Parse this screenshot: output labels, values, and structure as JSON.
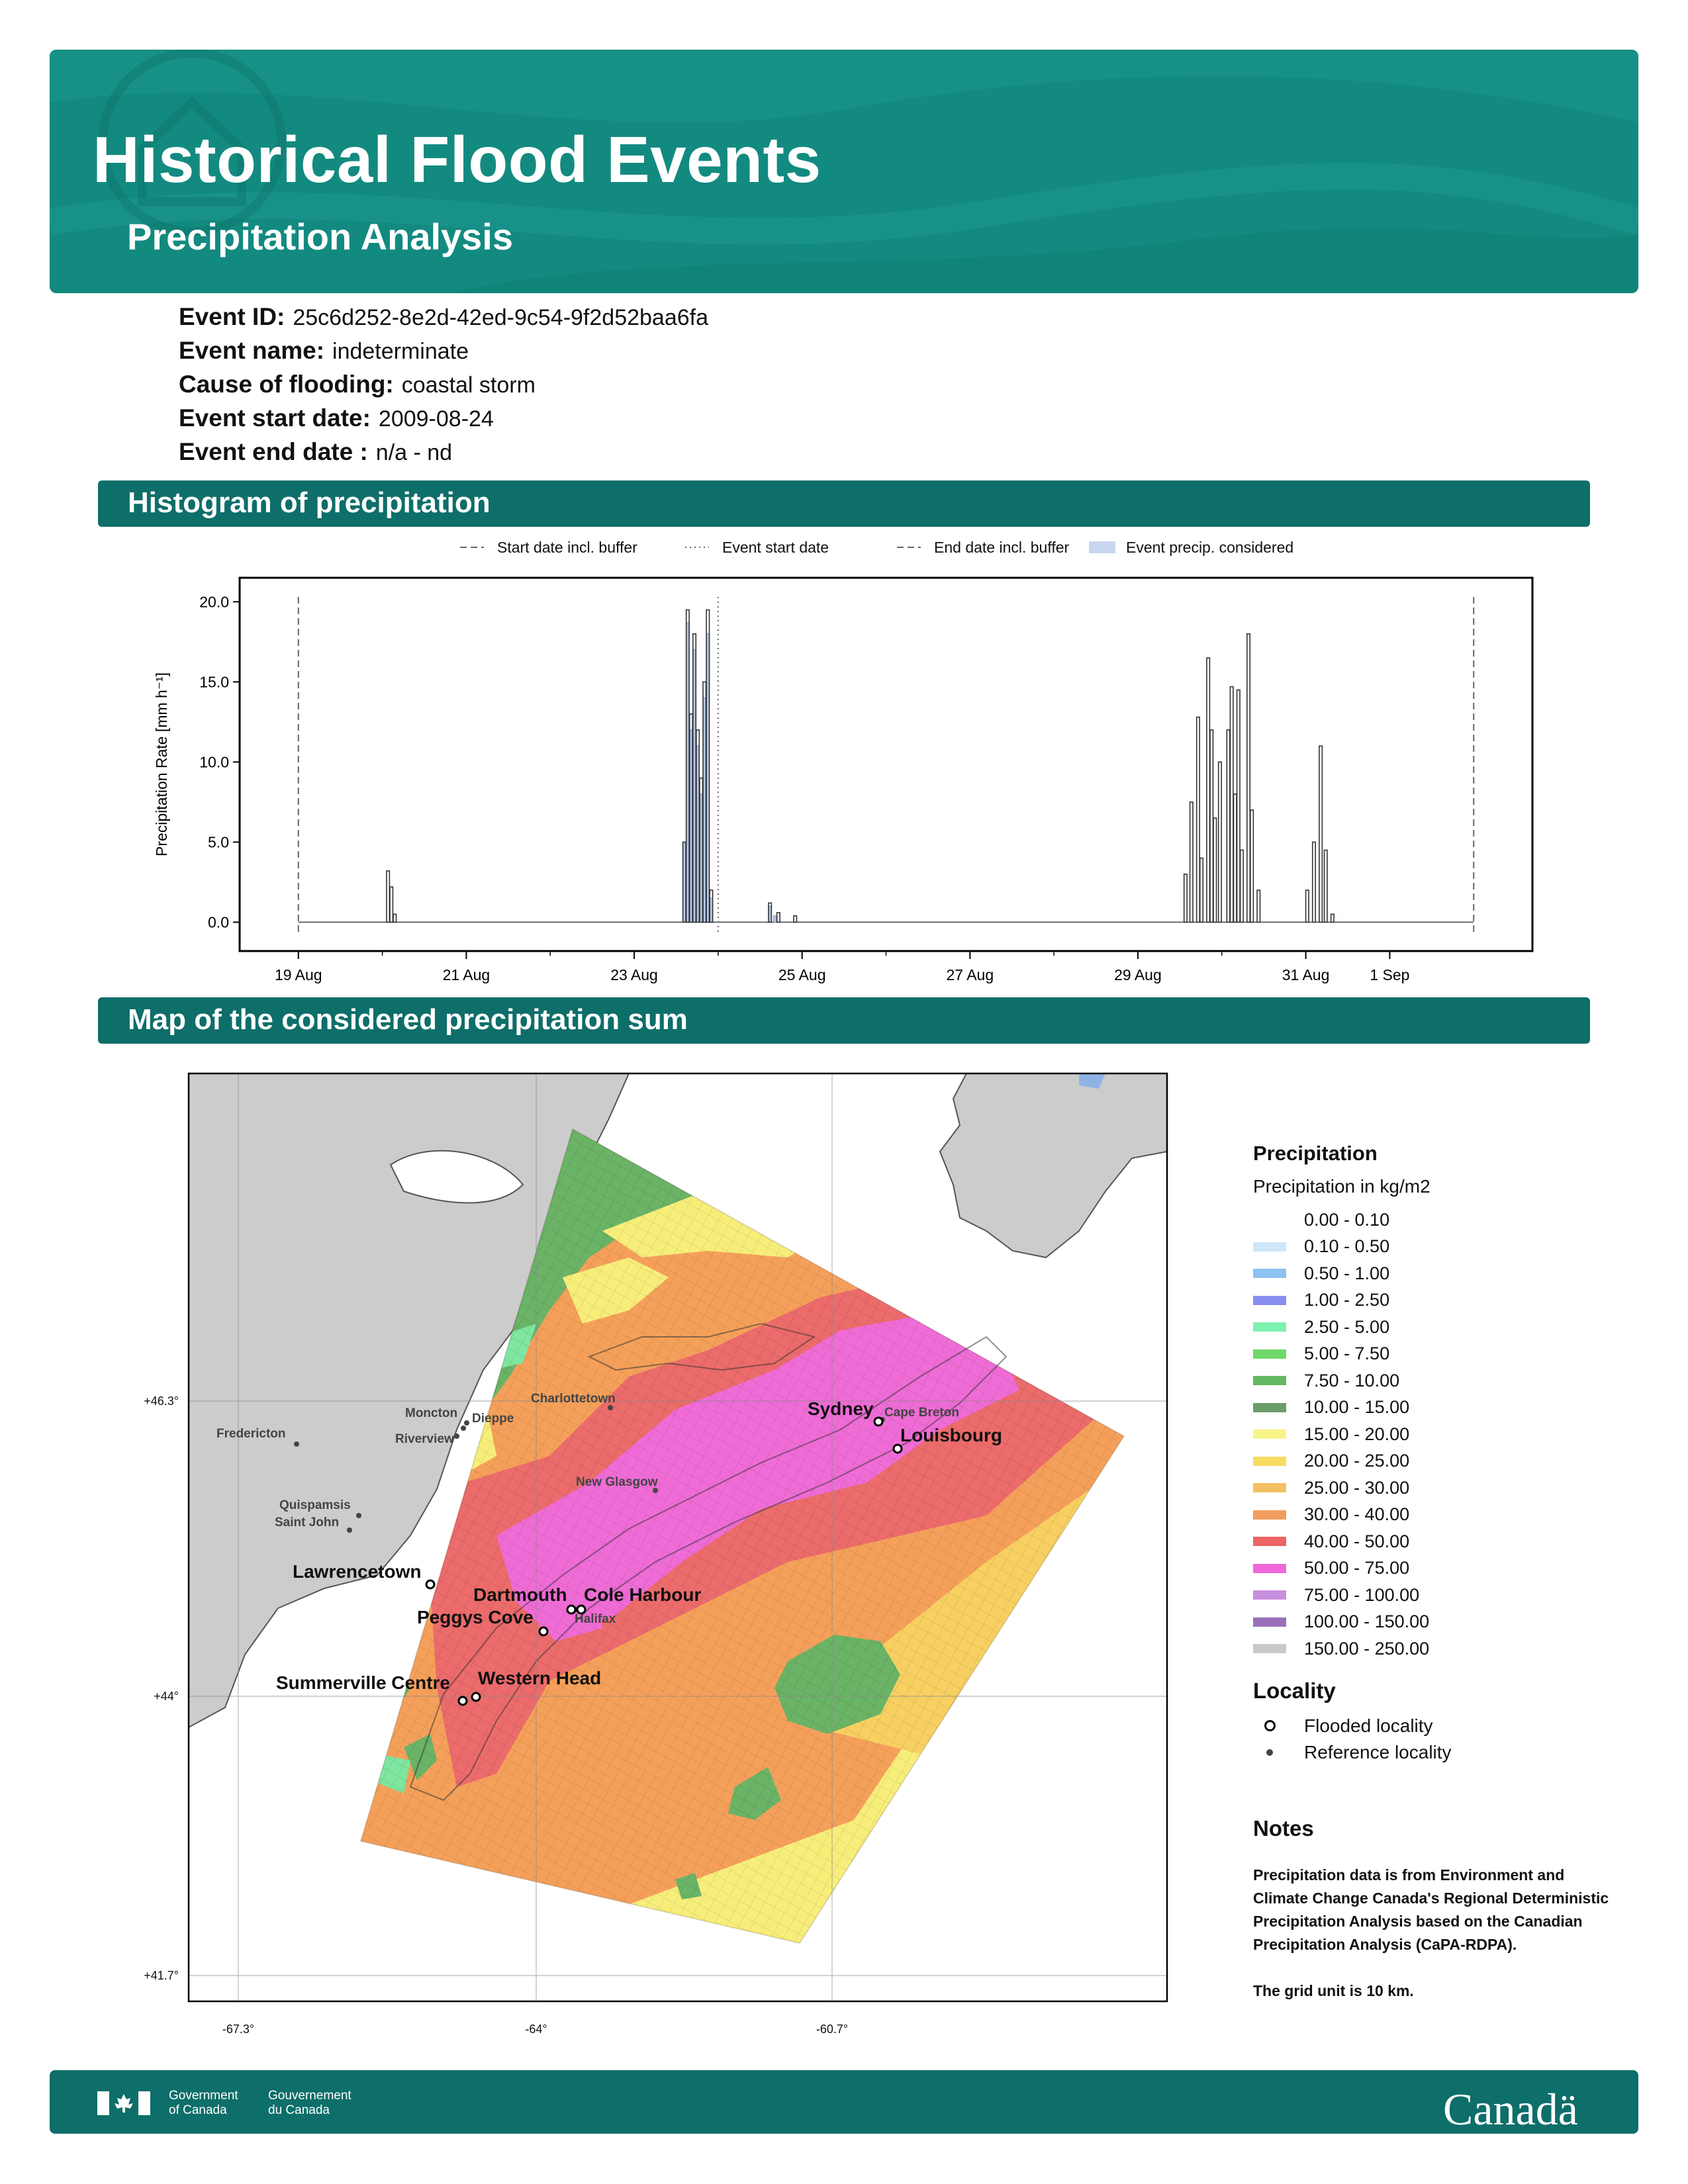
{
  "header": {
    "title": "Historical Flood Events",
    "subtitle": "Precipitation Analysis"
  },
  "event": {
    "id_label": "Event ID:",
    "id": "25c6d252-8e2d-42ed-9c54-9f2d52baa6fa",
    "name_label": "Event name:",
    "name": "indeterminate",
    "cause_label": "Cause of flooding:",
    "cause": "coastal storm",
    "start_label": "Event start date:",
    "start": "2009-08-24",
    "end_label": "Event end date :",
    "end": "n/a - nd"
  },
  "sections": {
    "histogram": "Histogram of precipitation",
    "map": "Map of the considered precipitation sum"
  },
  "chart_data": {
    "type": "bar",
    "ylabel": "Precipitation Rate [mm h⁻¹]",
    "ylim": [
      -1.8,
      21.5
    ],
    "yticks": [
      "0.0",
      "5.0",
      "10.0",
      "15.0",
      "20.0"
    ],
    "x_ticks": [
      {
        "day": 0,
        "label": "19 Aug"
      },
      {
        "day": 2,
        "label": "21 Aug"
      },
      {
        "day": 4,
        "label": "23 Aug"
      },
      {
        "day": 6,
        "label": "25 Aug"
      },
      {
        "day": 8,
        "label": "27 Aug"
      },
      {
        "day": 10,
        "label": "29 Aug"
      },
      {
        "day": 12,
        "label": "31 Aug"
      },
      {
        "day": 13,
        "label": "1 Sep"
      }
    ],
    "legend": [
      {
        "label": "Start date incl. buffer",
        "style": "dashed"
      },
      {
        "label": "Event start date",
        "style": "dotted"
      },
      {
        "label": "End date incl. buffer",
        "style": "dashed"
      },
      {
        "label": "Event precip. considered",
        "style": "fill",
        "color": "#c8d6ee"
      }
    ],
    "start_buffer_day": 0,
    "event_start_day": 5.0,
    "end_buffer_day": 14,
    "outline_bars": [
      [
        1.05,
        3.2
      ],
      [
        1.09,
        2.2
      ],
      [
        1.13,
        0.5
      ],
      [
        4.58,
        5.0
      ],
      [
        4.62,
        19.5
      ],
      [
        4.66,
        13.0
      ],
      [
        4.7,
        18.0
      ],
      [
        4.74,
        12.0
      ],
      [
        4.78,
        9.0
      ],
      [
        4.82,
        15.0
      ],
      [
        4.86,
        19.5
      ],
      [
        4.9,
        2.0
      ],
      [
        5.6,
        1.2
      ],
      [
        5.7,
        0.6
      ],
      [
        5.9,
        0.4
      ],
      [
        10.55,
        3.0
      ],
      [
        10.62,
        7.5
      ],
      [
        10.7,
        12.8
      ],
      [
        10.74,
        4.0
      ],
      [
        10.82,
        16.5
      ],
      [
        10.86,
        12.0
      ],
      [
        10.9,
        6.5
      ],
      [
        10.96,
        10.0
      ],
      [
        11.06,
        12.0
      ],
      [
        11.1,
        14.7
      ],
      [
        11.14,
        8.0
      ],
      [
        11.18,
        14.5
      ],
      [
        11.22,
        4.5
      ],
      [
        11.3,
        18.0
      ],
      [
        11.34,
        7.0
      ],
      [
        11.42,
        2.0
      ],
      [
        12.0,
        2.0
      ],
      [
        12.08,
        5.0
      ],
      [
        12.16,
        11.0
      ],
      [
        12.22,
        4.5
      ],
      [
        12.3,
        0.5
      ]
    ],
    "filled_bars": [
      [
        4.58,
        5.0
      ],
      [
        4.62,
        18.7
      ],
      [
        4.66,
        12.0
      ],
      [
        4.7,
        17.0
      ],
      [
        4.74,
        11.0
      ],
      [
        4.78,
        8.0
      ],
      [
        4.82,
        14.0
      ],
      [
        4.86,
        18.0
      ],
      [
        4.9,
        1.5
      ],
      [
        5.6,
        1.0
      ],
      [
        5.66,
        0.4
      ]
    ]
  },
  "map": {
    "lat_labels": [
      "+46.3°",
      "+44°",
      "+41.7°"
    ],
    "lon_labels": [
      "-67.3°",
      "-64°",
      "-60.7°"
    ],
    "flooded_localities": [
      "Sydney",
      "Louisbourg",
      "Lawrencetown",
      "Dartmouth",
      "Cole Harbour",
      "Peggys Cove",
      "Western Head",
      "Summerville Centre"
    ],
    "reference_localities": [
      "Cape Breton",
      "Charlottetown",
      "Moncton",
      "Dieppe",
      "Riverview",
      "Fredericton",
      "New Glasgow",
      "Quispamsis",
      "Saint John",
      "Halifax"
    ],
    "colors": {
      "land": "#cccccc",
      "green_dark": "#64a86a",
      "green": "#6fc86a",
      "yellow": "#f5f07c",
      "yellow_orange": "#f8d060",
      "orange": "#f3a457",
      "salmon": "#f08867",
      "red": "#ec6b6b",
      "pink": "#ec6fd0"
    }
  },
  "legend": {
    "title": "Precipitation",
    "subtitle": "Precipitation in kg/m2",
    "items": [
      {
        "label": "0.00 - 0.10",
        "color": "#ffffff"
      },
      {
        "label": "0.10 - 0.50",
        "color": "#cfe6f8"
      },
      {
        "label": "0.50 - 1.00",
        "color": "#8cc2f2"
      },
      {
        "label": "1.00 - 2.50",
        "color": "#8a8ef0"
      },
      {
        "label": "2.50 - 5.00",
        "color": "#7ef0b0"
      },
      {
        "label": "5.00 - 7.50",
        "color": "#6fd86a"
      },
      {
        "label": "7.50 - 10.00",
        "color": "#64b860"
      },
      {
        "label": "10.00 - 15.00",
        "color": "#6a9e6a"
      },
      {
        "label": "15.00 - 20.00",
        "color": "#f7f587"
      },
      {
        "label": "20.00 - 25.00",
        "color": "#f8dc64"
      },
      {
        "label": "25.00 - 30.00",
        "color": "#f5c063"
      },
      {
        "label": "30.00 - 40.00",
        "color": "#f29c5f"
      },
      {
        "label": "40.00 - 50.00",
        "color": "#ec6464"
      },
      {
        "label": "50.00 - 75.00",
        "color": "#f068d8"
      },
      {
        "label": "75.00 - 100.00",
        "color": "#c88ee0"
      },
      {
        "label": "100.00 - 150.00",
        "color": "#9a70b8"
      },
      {
        "label": "150.00 - 250.00",
        "color": "#c8c8c8"
      }
    ]
  },
  "locality": {
    "title": "Locality",
    "flooded": "Flooded locality",
    "reference": "Reference locality"
  },
  "notes": {
    "title": "Notes",
    "text1": "Precipitation data is from Environment and Climate Change Canada's Regional Deterministic Precipitation Analysis based on the Canadian Precipitation Analysis (CaPA-RDPA).",
    "text2": "The grid unit is 10 km."
  },
  "footer": {
    "gov_en_1": "Government",
    "gov_en_2": "of Canada",
    "gov_fr_1": "Gouvernement",
    "gov_fr_2": "du Canada",
    "wordmark": "Canadä"
  }
}
